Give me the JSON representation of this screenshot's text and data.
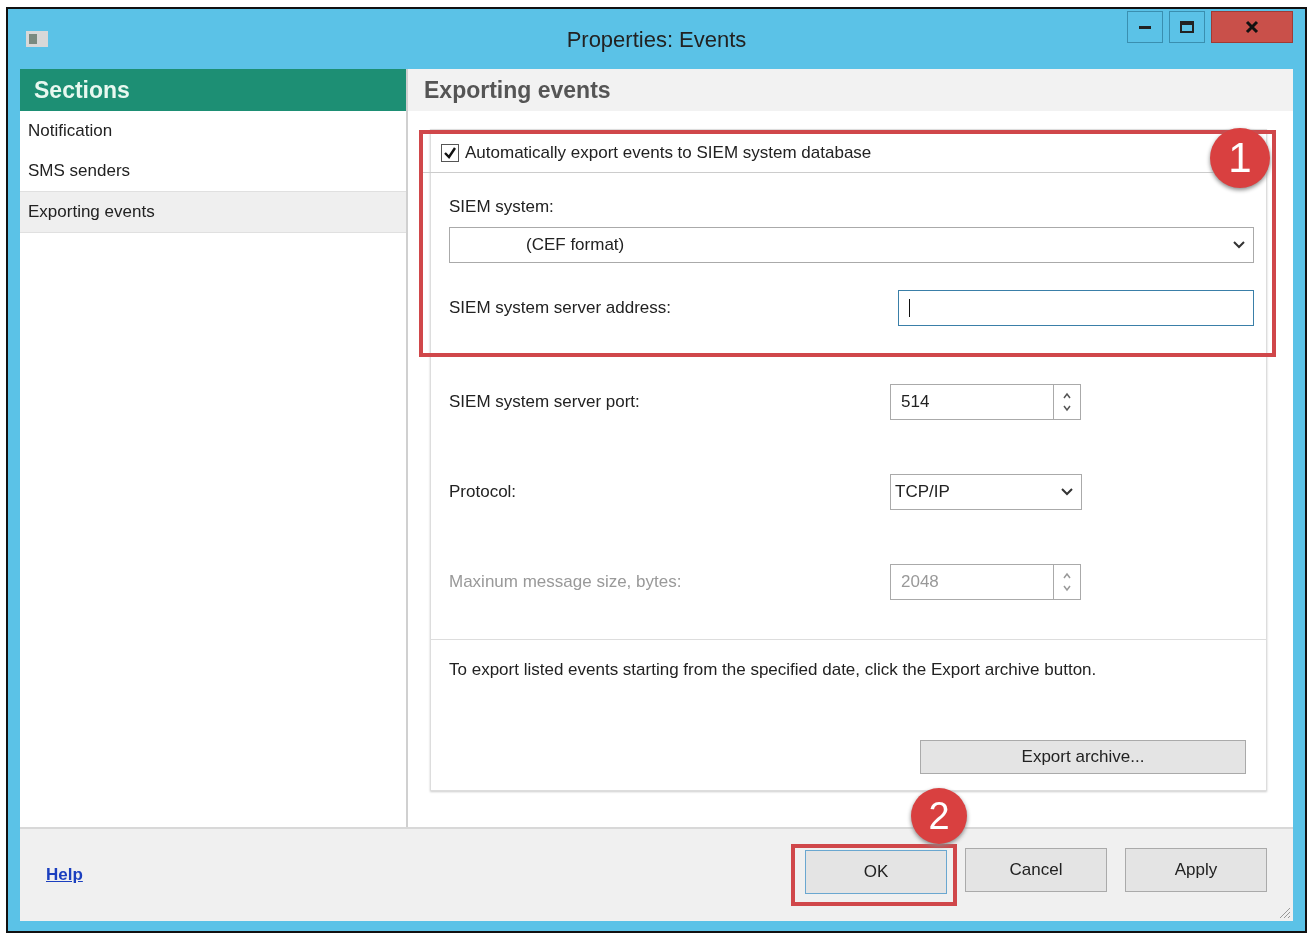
{
  "window": {
    "title": "Properties: Events"
  },
  "sidebar": {
    "title": "Sections",
    "items": [
      {
        "label": "Notification",
        "selected": false
      },
      {
        "label": "SMS senders",
        "selected": false
      },
      {
        "label": "Exporting events",
        "selected": true
      }
    ]
  },
  "panel": {
    "title": "Exporting events",
    "highlighted": true,
    "auto_export": {
      "label": "Automatically export events to SIEM system database",
      "checked": true
    },
    "siem_system": {
      "label": "SIEM system:",
      "value": "(CEF format)"
    },
    "server_address": {
      "label": "SIEM system server address:",
      "focused": true
    },
    "server_port": {
      "label": "SIEM system server port:",
      "value": "514"
    },
    "protocol": {
      "label": "Protocol:",
      "value": "TCP/IP"
    },
    "max_message_size": {
      "label": "Maxinum message size, bytes:",
      "value": "2048",
      "disabled": true
    },
    "archive_note": "To export listed events starting from the specified date, click the Export archive button.",
    "export_button": "Export archive..."
  },
  "footer": {
    "help_link": "Help",
    "buttons": [
      {
        "label": "OK",
        "highlighted": true
      },
      {
        "label": "Cancel",
        "highlighted": false
      },
      {
        "label": "Apply",
        "highlighted": false
      }
    ]
  },
  "callouts": [
    {
      "label": "1"
    },
    {
      "label": "2"
    }
  ]
}
